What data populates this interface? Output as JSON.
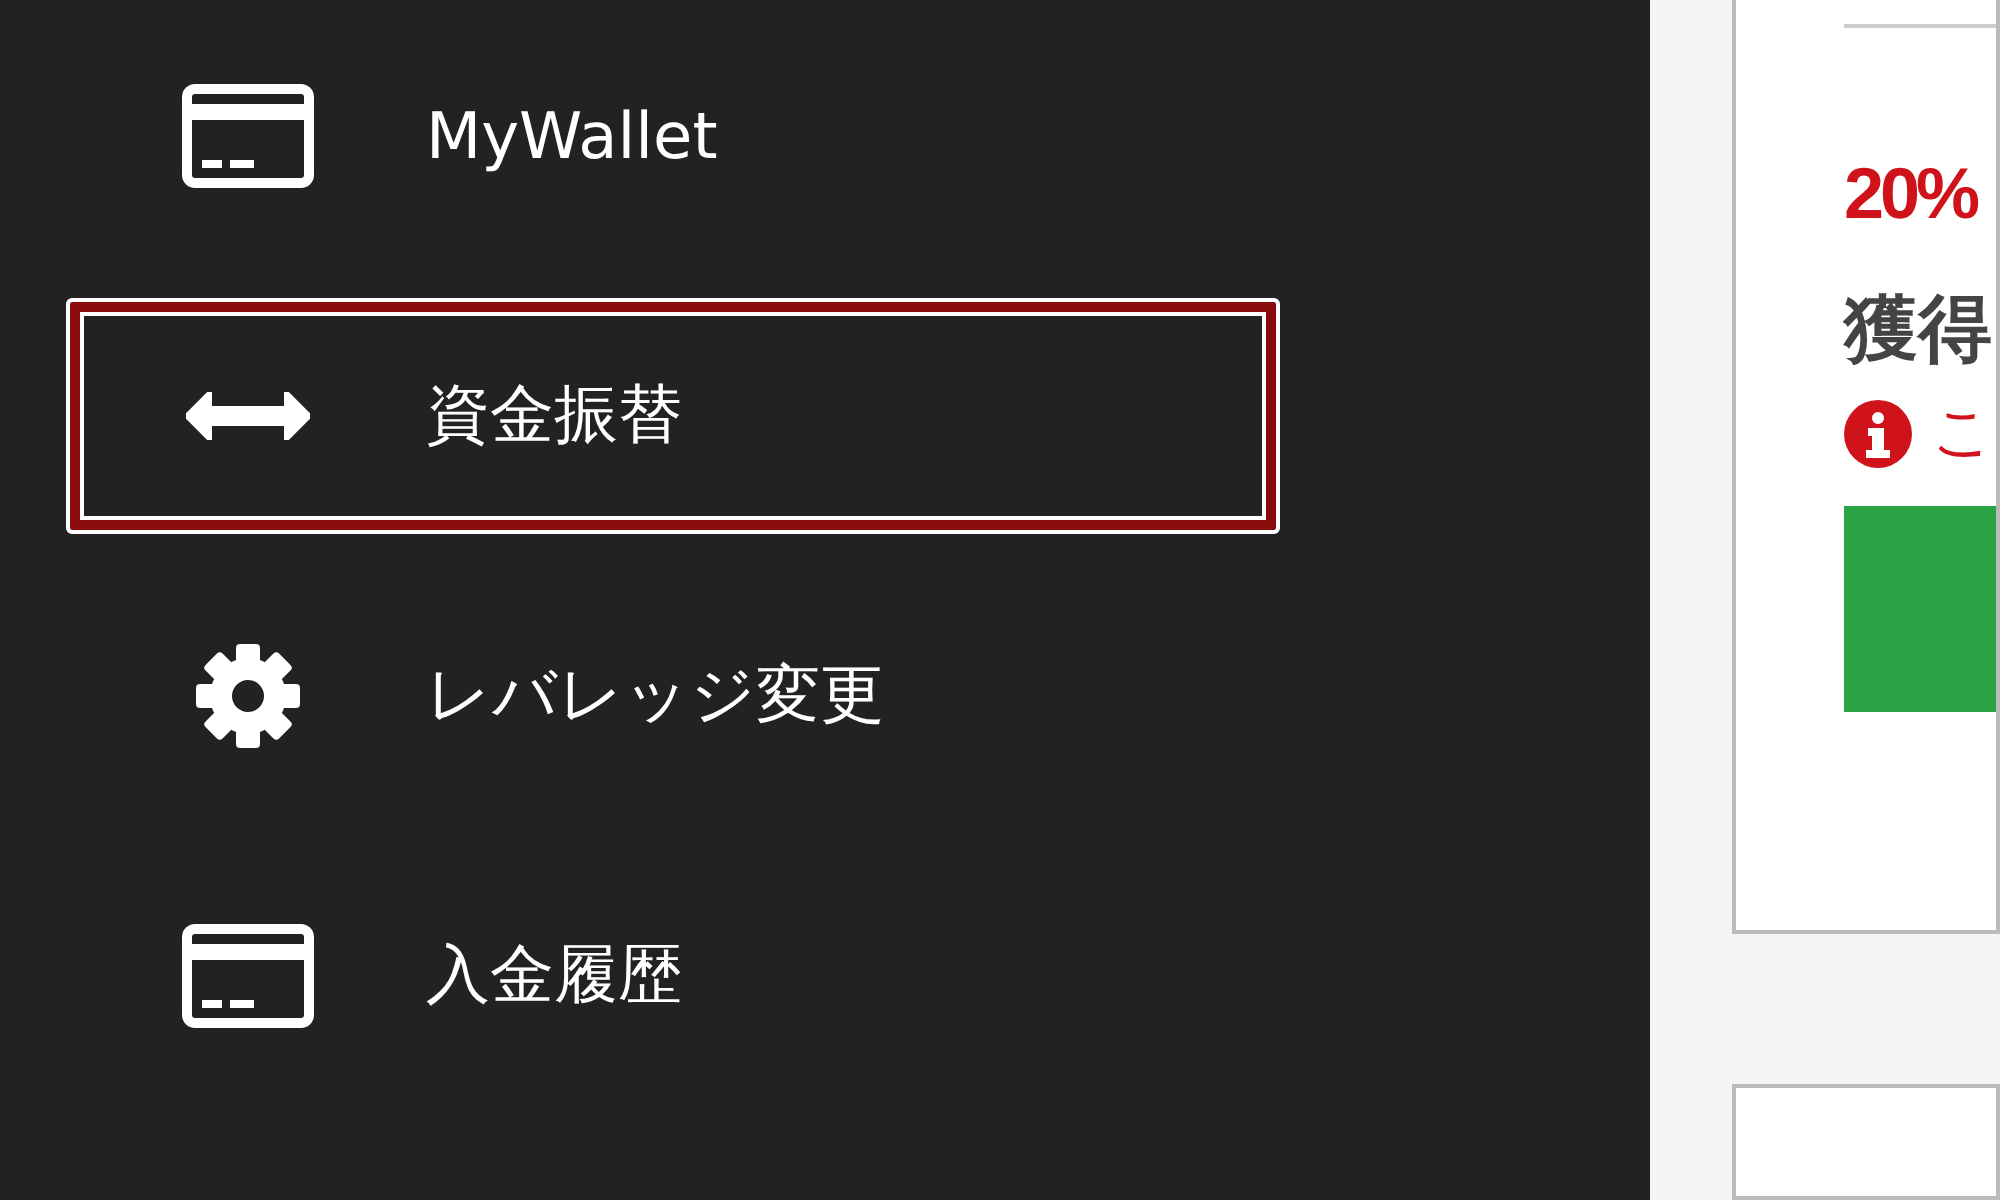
{
  "sidebar": {
    "items": [
      {
        "kind": "card",
        "label": "MyWallet",
        "selected": false
      },
      {
        "kind": "arrows",
        "label": "資金振替",
        "selected": true
      },
      {
        "kind": "gear",
        "label": "レバレッジ変更",
        "selected": false
      },
      {
        "kind": "card",
        "label": "入金履歴",
        "selected": false
      }
    ]
  },
  "card": {
    "rate": "20%",
    "heading": "獲得",
    "notice": "こ"
  }
}
